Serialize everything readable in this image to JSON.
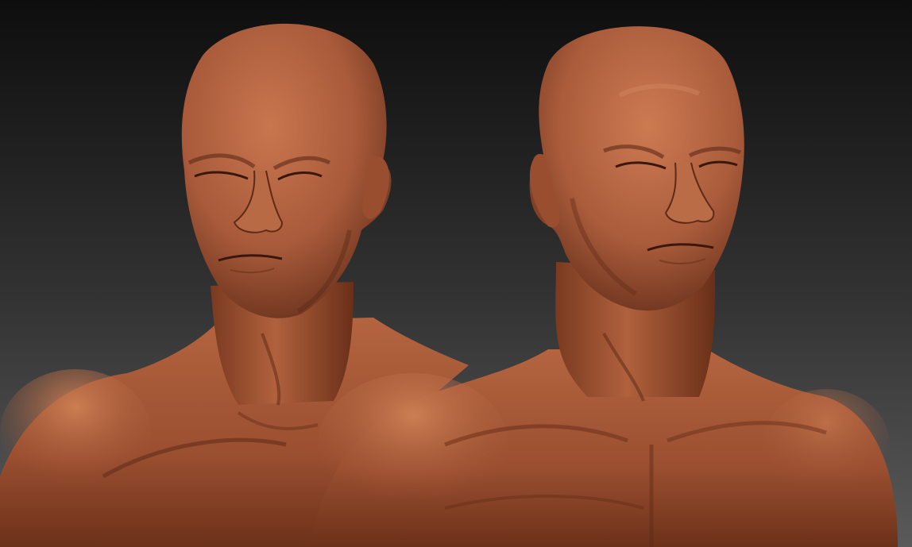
{
  "scene": {
    "type": "3d-sculpt-render",
    "subjects": [
      "male-bust-three-quarter-left",
      "male-bust-three-quarter-right"
    ],
    "material": "clay",
    "colors": {
      "background_top": "#0e0e0e",
      "background_bottom": "#5a5a5a",
      "clay_base": "#a85a3a",
      "clay_light": "#c8764e",
      "clay_shadow": "#5e2a17",
      "clay_deep": "#3a170c"
    }
  }
}
